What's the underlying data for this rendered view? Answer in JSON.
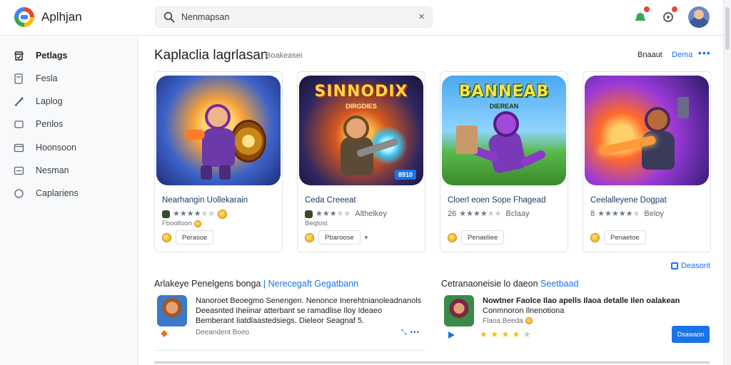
{
  "app": {
    "title": "Aplhjan"
  },
  "search": {
    "value": "Nenmapsan",
    "clear_glyph": "×"
  },
  "toolbar": {
    "icons": [
      "bell-icon",
      "settings-icon",
      "avatar"
    ]
  },
  "sidebar": {
    "items": [
      {
        "label": "Petlags",
        "icon": "store-icon",
        "active": true
      },
      {
        "label": "Fesla",
        "icon": "document-icon",
        "active": false
      },
      {
        "label": "Laplog",
        "icon": "rocket-icon",
        "active": false
      },
      {
        "label": "Penlos",
        "icon": "folder-icon",
        "active": false
      },
      {
        "label": "Hoonsoon",
        "icon": "window-icon",
        "active": false
      },
      {
        "label": "Nesman",
        "icon": "list-icon",
        "active": false
      },
      {
        "label": "Caplariens",
        "icon": "circle-icon",
        "active": false
      }
    ]
  },
  "section": {
    "title": "Kaplaclia lagrlasan",
    "subtitle": "Boakeasei",
    "link_primary": "Bnaaut",
    "link_secondary": "Dema",
    "more_glyph": "•••"
  },
  "cards": [
    {
      "title": "Nearhangin Uollekarain",
      "rating_text": "",
      "stars": 4,
      "meta": "Fboolloon",
      "button": "Perasoe",
      "banner": "",
      "banner_sub": "",
      "badge": "",
      "theme": "hero"
    },
    {
      "title": "Ceda Creeeat",
      "rating_text": "Althelkey",
      "stars": 3,
      "meta": "Beqlost",
      "button": "Pbaroose",
      "banner": "SINNODIX",
      "banner_sub": "DIRGDIES",
      "badge": "8910",
      "theme": "gunner"
    },
    {
      "title": "Cloerl eoen Sope Fhagead",
      "rating_text": "Bclaay",
      "stars": 4,
      "meta": "",
      "button": "Penaeliee",
      "banner": "BANNEAB",
      "banner_sub": "DIEREAN",
      "badge": "",
      "theme": "runner"
    },
    {
      "title": "Ceelalleyene Dogpat",
      "rating_text": "Beloy",
      "stars": 5,
      "meta": "",
      "button": "Penaetoe",
      "banner": "",
      "banner_sub": "",
      "badge": "",
      "theme": "cyber"
    }
  ],
  "bottom": {
    "title_prefix": "Arlakeye Penelgens bonga",
    "title_suffix": "Nerecegaft Gegatbann",
    "title2_prefix": "Cetranaoneisie lo daeon",
    "title2_suffix": "Seetbaad",
    "view_link": "Deasorit",
    "review1": {
      "line1": "Nanoroet Beoegmo Senengen. Nenonce Inerehtnianoleadnanols",
      "line2": "Deeasnted Iheiinar atterbant se ramadlise Iloy Ideaeo",
      "line3": "Bemberant Iiatdlaastedsiegs. Dieleor Seagnaf 5.",
      "meta": "Deeandent Boeo",
      "actions": "⤡ •••"
    },
    "review2": {
      "line1": "Nowtner Faolce Ilao apells Ilaoa detalle Ilen oalakean",
      "line2": "Conmnoron Ilnenotiona",
      "stars": 4,
      "meta": "Flaoa Beeda",
      "cta": "Dsawaon"
    }
  },
  "colors": {
    "accent": "#1a73e8",
    "star": "#fbbc04",
    "sidebar_bg": "#f8f9fa"
  }
}
